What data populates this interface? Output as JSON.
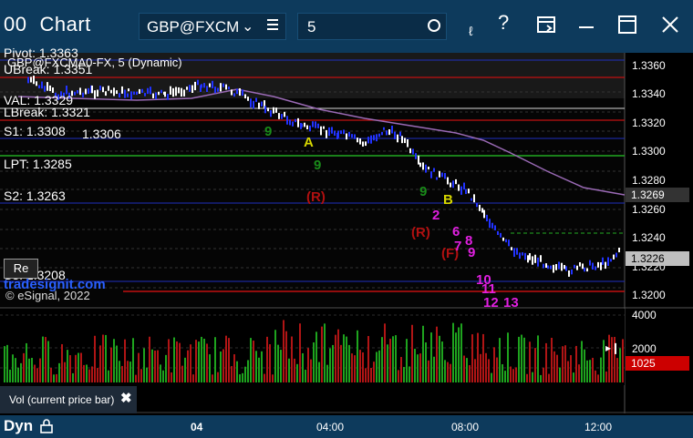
{
  "window": {
    "title": "Chart",
    "title_prefix": "00",
    "symbol": "GBP@FXCM",
    "interval": "5"
  },
  "chart_header": {
    "symbol_label": "GBP@FXCMA0-FX, 5 (Dynamic)"
  },
  "levels": [
    {
      "label": "Pivot: 1.3363",
      "color": "#1f2fbf"
    },
    {
      "label": "UBreak: 1.3351",
      "color": "#c21010"
    },
    {
      "label": "VAL: 1.3329",
      "color": "#e8e8e8"
    },
    {
      "label": "LBreak: 1.3321",
      "color": "#c21010"
    },
    {
      "label": "S1: 1.3308",
      "color": "#1f2fbf"
    },
    {
      "label": "LPT: 1.3285",
      "color": "#22aa22"
    },
    {
      "label": "S2: 1.3263",
      "color": "#1f2fbf"
    },
    {
      "label": "S3: 1.3208",
      "color": "#1f2fbf"
    }
  ],
  "price_label_extra": "1.3306",
  "y_axis": {
    "ticks": [
      "1.3360",
      "1.3340",
      "1.3320",
      "1.3300",
      "1.3280",
      "1.3260",
      "1.3240",
      "1.3220",
      "1.3200"
    ],
    "ma_tag": "1.3269",
    "price_tag": "1.3226"
  },
  "volume_axis": {
    "ticks": [
      "4000",
      "2000"
    ],
    "current_tag": "1025"
  },
  "annotations": {
    "A": "A",
    "B": "B",
    "R1": "(R)",
    "R2": "(R)",
    "F": "(F)",
    "n1": "9",
    "n2": "9",
    "n3": "9",
    "n4": "2",
    "n5": "6",
    "n6": "7",
    "n7": "8",
    "n8": "9",
    "n9": "10",
    "n10": "11",
    "n11": "12",
    "n12": "13"
  },
  "copyright": "© eSignal, 2022",
  "watermark": "tradesignit.com",
  "re_button": "Re",
  "legend": {
    "label": "Vol (current price bar)"
  },
  "bottom": {
    "dyn_label": "Dyn",
    "x_ticks": [
      "04",
      "04:00",
      "08:00",
      "12:00"
    ]
  },
  "colors": {
    "title_bar": "#0d3a5c",
    "up_bar": "#ffffff",
    "down_bar": "#2233ff",
    "ma_line": "#9a6ab5",
    "volume_tag": "#cc0000"
  }
}
